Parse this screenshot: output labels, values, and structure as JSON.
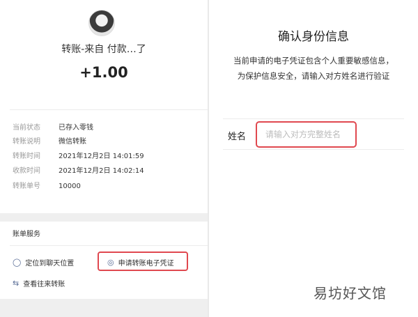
{
  "left": {
    "title": "转账-来自 付款…了",
    "amount": "+1.00",
    "details": [
      {
        "label": "当前状态",
        "value": "已存入零钱"
      },
      {
        "label": "转账说明",
        "value": "微信转账"
      },
      {
        "label": "转账时间",
        "value": "2021年12月2日 14:01:59"
      },
      {
        "label": "收款时间",
        "value": "2021年12月2日 14:02:14"
      },
      {
        "label": "转账单号",
        "value": "10000"
      }
    ],
    "services_title": "账单服务",
    "services": {
      "locate": "定位到聊天位置",
      "apply_voucher": "申请转账电子凭证",
      "view_history": "查看往来转账"
    }
  },
  "right": {
    "title": "确认身份信息",
    "description": "当前申请的电子凭证包含个人重要敏感信息，为保护信息安全，请输入对方姓名进行验证",
    "name_label": "姓名",
    "name_placeholder": "请输入对方完整姓名"
  },
  "watermark": "易坊好文馆",
  "colors": {
    "highlight": "#e0484f",
    "link_icon": "#576b95",
    "separator": "#e9e9e9"
  }
}
